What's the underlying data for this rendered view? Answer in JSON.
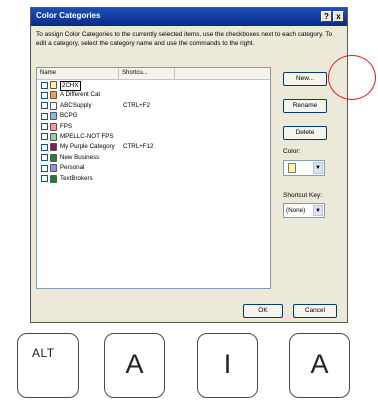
{
  "dialog": {
    "title": "Color Categories",
    "help_label": "?",
    "close_label": "x",
    "instructions": "To assign Color Categories to the currently selected items, use the checkboxes next to each category.  To edit a category, select the category name and use the commands to the right."
  },
  "list": {
    "headers": {
      "name": "Name",
      "shortcut": "Shortcu..."
    },
    "items": [
      {
        "name": "2CHX",
        "shortcut": "",
        "color": "#fff59a",
        "editing": true
      },
      {
        "name": "A Different Cat",
        "shortcut": "",
        "color": "#f2a24a"
      },
      {
        "name": "ABCSupply",
        "shortcut": "CTRL+F2",
        "color": "#ffffff"
      },
      {
        "name": "BCPG",
        "shortcut": "",
        "color": "#8db4e2"
      },
      {
        "name": "FPS",
        "shortcut": "",
        "color": "#f59a9a"
      },
      {
        "name": "MPELLC-NOT FPS",
        "shortcut": "",
        "color": "#8fd19e"
      },
      {
        "name": "My Purple Category",
        "shortcut": "CTRL+F12",
        "color": "#7b1f5e"
      },
      {
        "name": "New Business",
        "shortcut": "",
        "color": "#2e7d32"
      },
      {
        "name": "Personal",
        "shortcut": "",
        "color": "#9d8ee0"
      },
      {
        "name": "TextBrokers",
        "shortcut": "",
        "color": "#1f7a3e"
      }
    ]
  },
  "buttons": {
    "new_label": "New...",
    "rename_label": "Rename",
    "delete_label": "Delete",
    "ok_label": "OK",
    "cancel_label": "Cancel"
  },
  "side": {
    "color_label": "Color:",
    "shortcut_label": "Shortcut Key:",
    "shortcut_value": "(None)",
    "selected_color": "#fff59a"
  },
  "annotation": {
    "circle_color": "#e31b1b"
  },
  "keys": {
    "alt": "ALT",
    "key2": "A",
    "key3": "I",
    "key4": "A"
  }
}
